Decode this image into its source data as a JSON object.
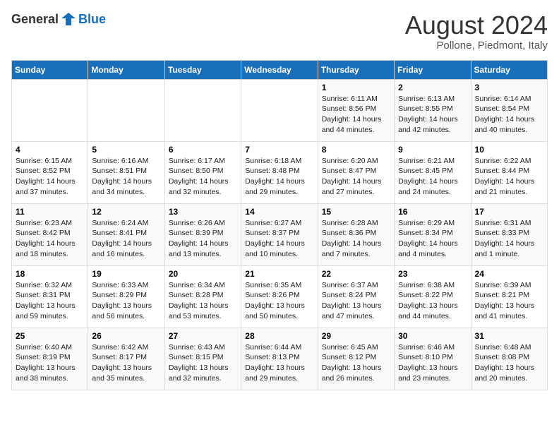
{
  "header": {
    "logo_general": "General",
    "logo_blue": "Blue",
    "month_year": "August 2024",
    "location": "Pollone, Piedmont, Italy"
  },
  "days_of_week": [
    "Sunday",
    "Monday",
    "Tuesday",
    "Wednesday",
    "Thursday",
    "Friday",
    "Saturday"
  ],
  "weeks": [
    [
      {
        "day": "",
        "info": ""
      },
      {
        "day": "",
        "info": ""
      },
      {
        "day": "",
        "info": ""
      },
      {
        "day": "",
        "info": ""
      },
      {
        "day": "1",
        "info": "Sunrise: 6:11 AM\nSunset: 8:56 PM\nDaylight: 14 hours\nand 44 minutes."
      },
      {
        "day": "2",
        "info": "Sunrise: 6:13 AM\nSunset: 8:55 PM\nDaylight: 14 hours\nand 42 minutes."
      },
      {
        "day": "3",
        "info": "Sunrise: 6:14 AM\nSunset: 8:54 PM\nDaylight: 14 hours\nand 40 minutes."
      }
    ],
    [
      {
        "day": "4",
        "info": "Sunrise: 6:15 AM\nSunset: 8:52 PM\nDaylight: 14 hours\nand 37 minutes."
      },
      {
        "day": "5",
        "info": "Sunrise: 6:16 AM\nSunset: 8:51 PM\nDaylight: 14 hours\nand 34 minutes."
      },
      {
        "day": "6",
        "info": "Sunrise: 6:17 AM\nSunset: 8:50 PM\nDaylight: 14 hours\nand 32 minutes."
      },
      {
        "day": "7",
        "info": "Sunrise: 6:18 AM\nSunset: 8:48 PM\nDaylight: 14 hours\nand 29 minutes."
      },
      {
        "day": "8",
        "info": "Sunrise: 6:20 AM\nSunset: 8:47 PM\nDaylight: 14 hours\nand 27 minutes."
      },
      {
        "day": "9",
        "info": "Sunrise: 6:21 AM\nSunset: 8:45 PM\nDaylight: 14 hours\nand 24 minutes."
      },
      {
        "day": "10",
        "info": "Sunrise: 6:22 AM\nSunset: 8:44 PM\nDaylight: 14 hours\nand 21 minutes."
      }
    ],
    [
      {
        "day": "11",
        "info": "Sunrise: 6:23 AM\nSunset: 8:42 PM\nDaylight: 14 hours\nand 18 minutes."
      },
      {
        "day": "12",
        "info": "Sunrise: 6:24 AM\nSunset: 8:41 PM\nDaylight: 14 hours\nand 16 minutes."
      },
      {
        "day": "13",
        "info": "Sunrise: 6:26 AM\nSunset: 8:39 PM\nDaylight: 14 hours\nand 13 minutes."
      },
      {
        "day": "14",
        "info": "Sunrise: 6:27 AM\nSunset: 8:37 PM\nDaylight: 14 hours\nand 10 minutes."
      },
      {
        "day": "15",
        "info": "Sunrise: 6:28 AM\nSunset: 8:36 PM\nDaylight: 14 hours\nand 7 minutes."
      },
      {
        "day": "16",
        "info": "Sunrise: 6:29 AM\nSunset: 8:34 PM\nDaylight: 14 hours\nand 4 minutes."
      },
      {
        "day": "17",
        "info": "Sunrise: 6:31 AM\nSunset: 8:33 PM\nDaylight: 14 hours\nand 1 minute."
      }
    ],
    [
      {
        "day": "18",
        "info": "Sunrise: 6:32 AM\nSunset: 8:31 PM\nDaylight: 13 hours\nand 59 minutes."
      },
      {
        "day": "19",
        "info": "Sunrise: 6:33 AM\nSunset: 8:29 PM\nDaylight: 13 hours\nand 56 minutes."
      },
      {
        "day": "20",
        "info": "Sunrise: 6:34 AM\nSunset: 8:28 PM\nDaylight: 13 hours\nand 53 minutes."
      },
      {
        "day": "21",
        "info": "Sunrise: 6:35 AM\nSunset: 8:26 PM\nDaylight: 13 hours\nand 50 minutes."
      },
      {
        "day": "22",
        "info": "Sunrise: 6:37 AM\nSunset: 8:24 PM\nDaylight: 13 hours\nand 47 minutes."
      },
      {
        "day": "23",
        "info": "Sunrise: 6:38 AM\nSunset: 8:22 PM\nDaylight: 13 hours\nand 44 minutes."
      },
      {
        "day": "24",
        "info": "Sunrise: 6:39 AM\nSunset: 8:21 PM\nDaylight: 13 hours\nand 41 minutes."
      }
    ],
    [
      {
        "day": "25",
        "info": "Sunrise: 6:40 AM\nSunset: 8:19 PM\nDaylight: 13 hours\nand 38 minutes."
      },
      {
        "day": "26",
        "info": "Sunrise: 6:42 AM\nSunset: 8:17 PM\nDaylight: 13 hours\nand 35 minutes."
      },
      {
        "day": "27",
        "info": "Sunrise: 6:43 AM\nSunset: 8:15 PM\nDaylight: 13 hours\nand 32 minutes."
      },
      {
        "day": "28",
        "info": "Sunrise: 6:44 AM\nSunset: 8:13 PM\nDaylight: 13 hours\nand 29 minutes."
      },
      {
        "day": "29",
        "info": "Sunrise: 6:45 AM\nSunset: 8:12 PM\nDaylight: 13 hours\nand 26 minutes."
      },
      {
        "day": "30",
        "info": "Sunrise: 6:46 AM\nSunset: 8:10 PM\nDaylight: 13 hours\nand 23 minutes."
      },
      {
        "day": "31",
        "info": "Sunrise: 6:48 AM\nSunset: 8:08 PM\nDaylight: 13 hours\nand 20 minutes."
      }
    ]
  ]
}
